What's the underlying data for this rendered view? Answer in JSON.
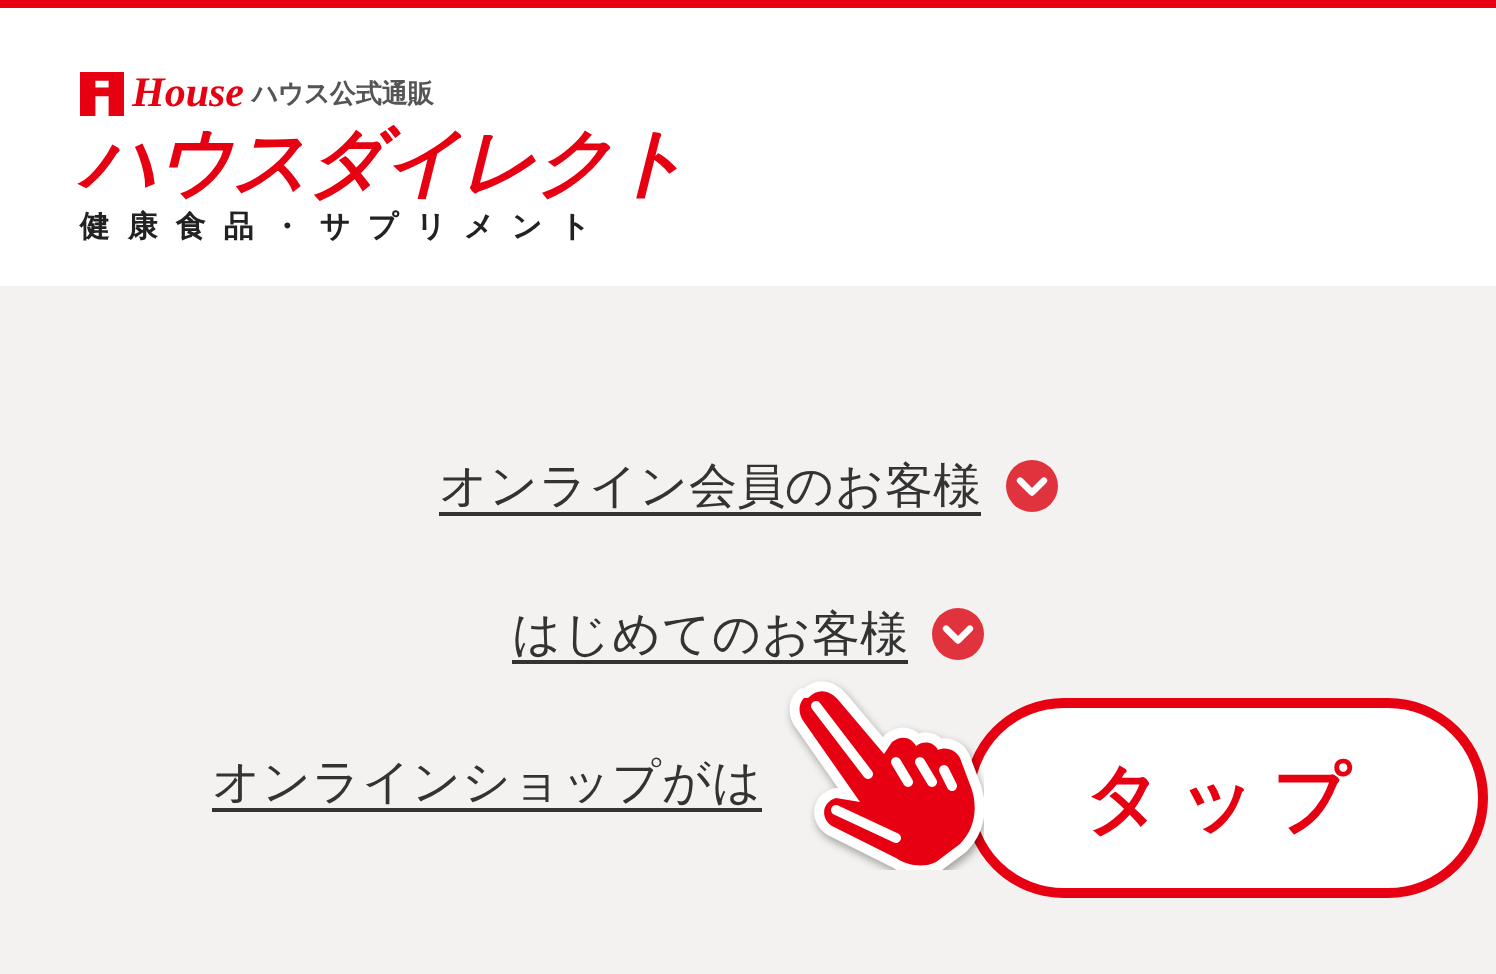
{
  "logo": {
    "brand": "House",
    "tagline": "ハウス公式通販",
    "name": "ハウスダイレクト",
    "subtitle": "健康食品・サプリメント"
  },
  "links": [
    {
      "label": "オンライン会員のお客様",
      "chevron": true
    },
    {
      "label": "はじめてのお客様",
      "chevron": true
    },
    {
      "label": "オンラインショップがは",
      "chevron": false
    }
  ],
  "callout": {
    "label": "タップ"
  }
}
